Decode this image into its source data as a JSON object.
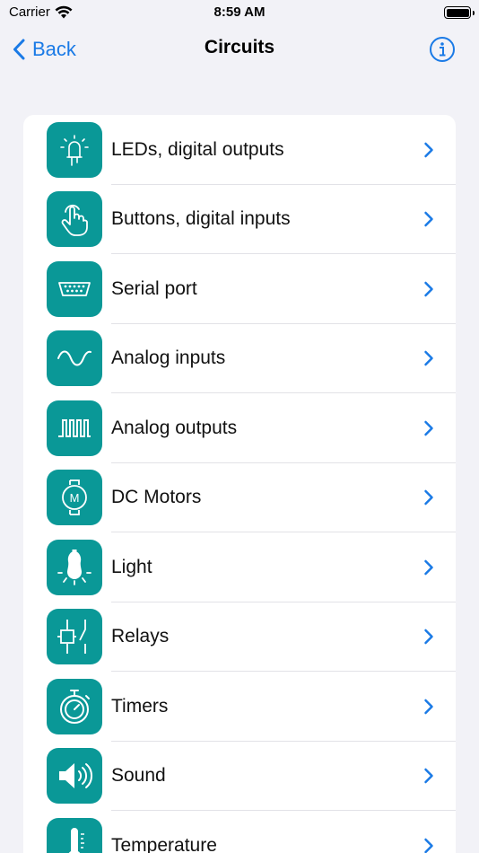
{
  "status_bar": {
    "carrier": "Carrier",
    "time": "8:59 AM"
  },
  "nav": {
    "back_label": "Back",
    "title": "Circuits"
  },
  "colors": {
    "accent": "#1a7ae6",
    "tile": "#0a9897",
    "background": "#f2f2f7"
  },
  "items": [
    {
      "label": "LEDs, digital outputs",
      "icon": "led-icon"
    },
    {
      "label": "Buttons, digital inputs",
      "icon": "hand-pointer-icon"
    },
    {
      "label": "Serial port",
      "icon": "serial-connector-icon"
    },
    {
      "label": "Analog inputs",
      "icon": "sine-wave-icon"
    },
    {
      "label": "Analog outputs",
      "icon": "pwm-wave-icon"
    },
    {
      "label": "DC Motors",
      "icon": "motor-icon"
    },
    {
      "label": "Light",
      "icon": "light-bulb-icon"
    },
    {
      "label": "Relays",
      "icon": "relay-icon"
    },
    {
      "label": "Timers",
      "icon": "stopwatch-icon"
    },
    {
      "label": "Sound",
      "icon": "speaker-icon"
    },
    {
      "label": "Temperature",
      "icon": "thermometer-icon"
    }
  ]
}
